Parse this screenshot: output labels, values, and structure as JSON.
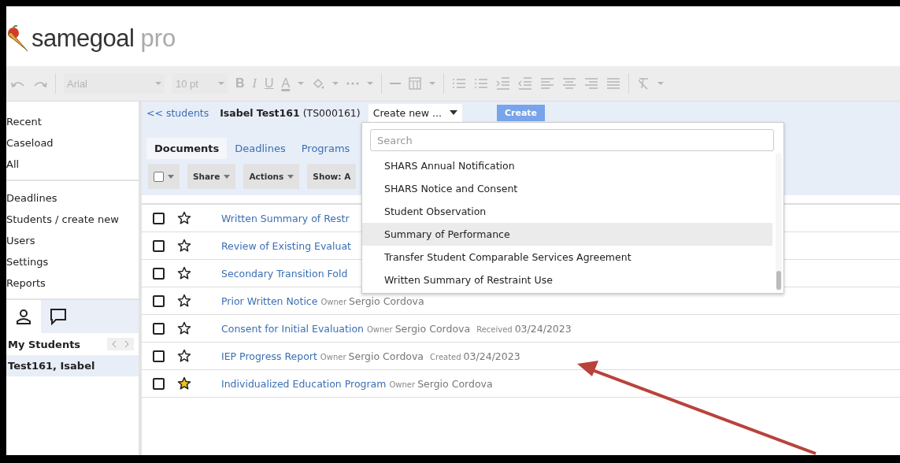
{
  "logo": {
    "name": "samegoal",
    "suffix": "pro"
  },
  "editor_toolbar": {
    "disabled": true,
    "font": "Arial",
    "font_size": "10 pt",
    "format_buttons": [
      "B",
      "I",
      "U",
      "A"
    ]
  },
  "sidebar": {
    "nav_groups": [
      [
        "Recent",
        "Caseload",
        "All"
      ],
      [
        "Deadlines",
        "Students / create new",
        "Users",
        "Settings",
        "Reports"
      ]
    ],
    "panel_tabs": [
      {
        "kind": "person",
        "selected": true
      },
      {
        "kind": "chat",
        "selected": false
      }
    ],
    "list_title": "My Students",
    "students": [
      {
        "name": "Test161, Isabel",
        "selected": true
      }
    ]
  },
  "student_bar": {
    "back_link": "<< students",
    "student": "**Isabel Test161** (TS000161)",
    "create_select": "Create new ...",
    "create_button": "Create"
  },
  "tabs": [
    {
      "label": "Documents",
      "selected": true
    },
    {
      "label": "Deadlines",
      "selected": false
    },
    {
      "label": "Programs",
      "selected": false
    }
  ],
  "actions": {
    "select_all_checked": false,
    "buttons": [
      {
        "label": "Share",
        "caret": true
      },
      {
        "label": "Actions",
        "caret": true
      },
      {
        "label": "Show: A",
        "caret": false
      }
    ]
  },
  "documents": [
    {
      "title": "Written Summary of Restr",
      "checked": false,
      "starred": false
    },
    {
      "title": "Review of Existing Evaluat",
      "checked": false,
      "starred": false
    },
    {
      "title": "Secondary Transition Fold",
      "checked": false,
      "starred": false
    },
    {
      "title": "Prior Written Notice",
      "checked": false,
      "starred": false,
      "owner_label": "Owner",
      "owner": "Sergio Cordova"
    },
    {
      "title": "Consent for Initial Evaluation",
      "checked": false,
      "starred": false,
      "owner_label": "Owner",
      "owner": "Sergio Cordova",
      "date_label": "Received",
      "date": "03/24/2023"
    },
    {
      "title": "IEP Progress Report",
      "checked": false,
      "starred": false,
      "owner_label": "Owner",
      "owner": "Sergio Cordova",
      "date_label": "Created",
      "date": "03/24/2023"
    },
    {
      "title": "Individualized Education Program",
      "checked": false,
      "starred": true,
      "owner_label": "Owner",
      "owner": "Sergio Cordova"
    }
  ],
  "create_menu": {
    "search_placeholder": "Search",
    "items": [
      {
        "label": "SHARS Annual Notification",
        "highlighted": false
      },
      {
        "label": "SHARS Notice and Consent",
        "highlighted": false
      },
      {
        "label": "Student Observation",
        "highlighted": false
      },
      {
        "label": "Summary of Performance",
        "highlighted": true
      },
      {
        "label": "Transfer Student Comparable Services Agreement",
        "highlighted": false
      },
      {
        "label": "Written Summary of Restraint Use",
        "highlighted": false
      }
    ]
  }
}
